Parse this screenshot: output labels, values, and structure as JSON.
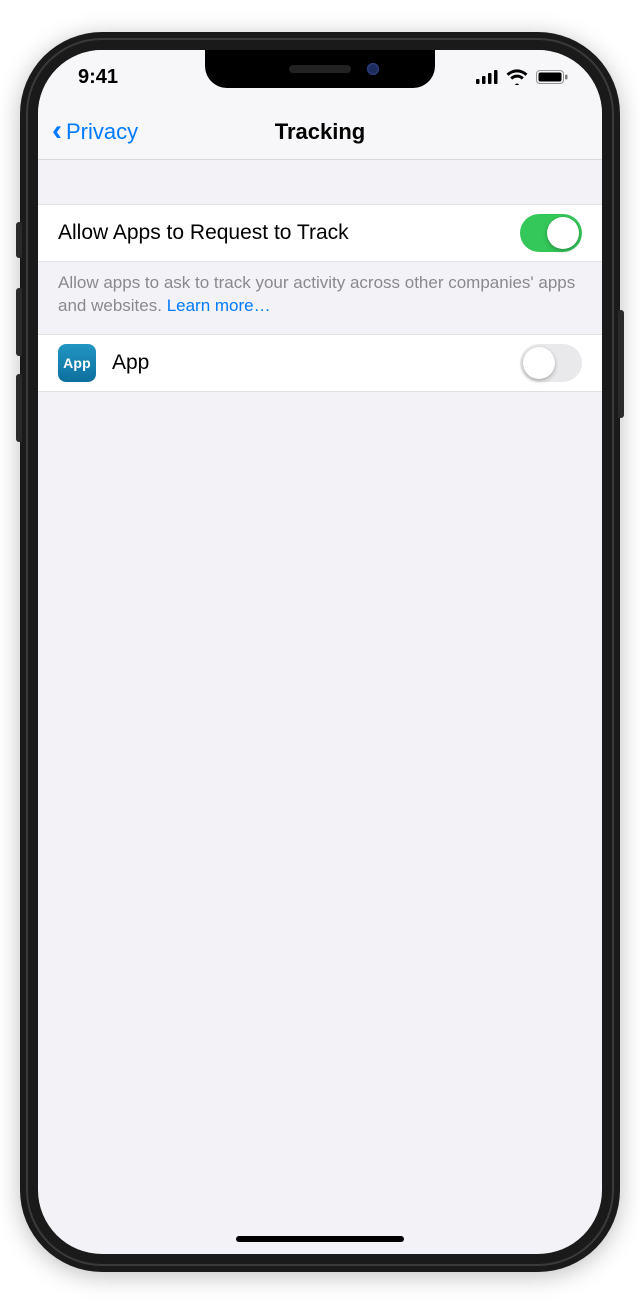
{
  "status": {
    "time": "9:41"
  },
  "nav": {
    "back_label": "Privacy",
    "title": "Tracking"
  },
  "sections": {
    "allow_request": {
      "label": "Allow Apps to Request to Track",
      "enabled": true,
      "footer_text": "Allow apps to ask to track your activity across other companies' apps and websites. ",
      "learn_more": "Learn more…"
    },
    "apps": [
      {
        "icon_label": "App",
        "name": "App",
        "enabled": false
      }
    ]
  }
}
